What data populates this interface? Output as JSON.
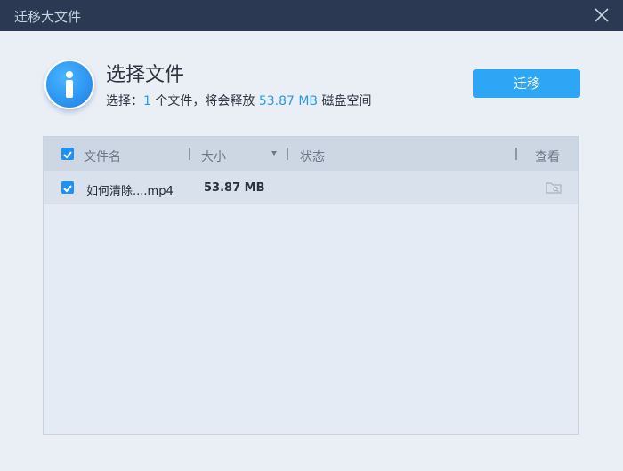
{
  "window": {
    "title": "迁移大文件",
    "close_icon": "close-icon"
  },
  "header": {
    "title": "选择文件",
    "summary_prefix": "选择：",
    "selected_count": "1",
    "summary_mid": " 个文件，将会释放 ",
    "size": "53.87 MB",
    "summary_suffix": " 磁盘空间",
    "info_icon": "info-icon"
  },
  "migrate_button": {
    "label": "迁移"
  },
  "table": {
    "columns": {
      "name": "文件名",
      "size": "大小",
      "status": "状态",
      "view": "查看"
    },
    "rows": [
      {
        "checked": true,
        "name": "如何清除....mp4",
        "size": "53.87 MB",
        "status": "",
        "view_icon": "folder-view-icon"
      }
    ]
  },
  "colors": {
    "titlebar": "#2b3a52",
    "accent": "#2ca6f5",
    "highlight": "#2b9ae8"
  }
}
